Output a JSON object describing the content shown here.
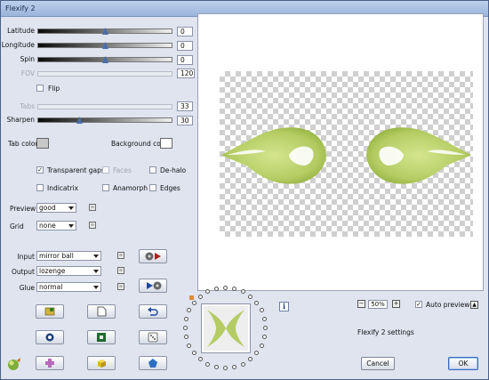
{
  "window": {
    "title": "Flexify 2"
  },
  "sliders": {
    "latitude": {
      "label": "Latitude",
      "value": "0",
      "level": 0.5
    },
    "longitude": {
      "label": "Longitude",
      "value": "0",
      "level": 0.5
    },
    "spin": {
      "label": "Spin",
      "value": "0",
      "level": 0.5
    },
    "fov": {
      "label": "FOV",
      "value": "120",
      "disabled": true
    },
    "tabs": {
      "label": "Tabs",
      "value": "33",
      "disabled": true
    },
    "sharpen": {
      "label": "Sharpen",
      "value": "30",
      "level": 0.3
    }
  },
  "flip": {
    "label": "Flip",
    "checked": false
  },
  "colors": {
    "tab_color_label": "Tab color",
    "tab_color": "#c8c8c8",
    "background_color_label": "Background color",
    "background_color": "#ffffff"
  },
  "options": {
    "transparent_gaps": {
      "label": "Transparent gaps",
      "checked": true
    },
    "faces": {
      "label": "Faces",
      "checked": false,
      "disabled": true
    },
    "de_halo": {
      "label": "De-halo",
      "checked": false
    },
    "indicatrix": {
      "label": "Indicatrix",
      "checked": false
    },
    "anamorph": {
      "label": "Anamorph",
      "checked": false
    },
    "edges": {
      "label": "Edges",
      "checked": false
    }
  },
  "preview_quality": {
    "label": "Preview",
    "value": "good"
  },
  "grid": {
    "label": "Grid",
    "value": "none"
  },
  "input": {
    "label": "Input",
    "value": "mirror ball"
  },
  "output": {
    "label": "Output",
    "value": "lozenge"
  },
  "glue": {
    "label": "Glue",
    "value": "normal"
  },
  "zoom": {
    "value": "50%",
    "minus": "−",
    "plus": "+"
  },
  "auto_preview": {
    "label": "Auto preview",
    "checked": true
  },
  "settings_label": "Flexify 2 settings",
  "buttons": {
    "cancel": "Cancel",
    "ok": "OK"
  },
  "info_icon": "i",
  "accent_colors": {
    "leaf": "#b6cf6a",
    "leaf_dark": "#8fae3c",
    "slider_thumb": "#4a6ea8"
  }
}
